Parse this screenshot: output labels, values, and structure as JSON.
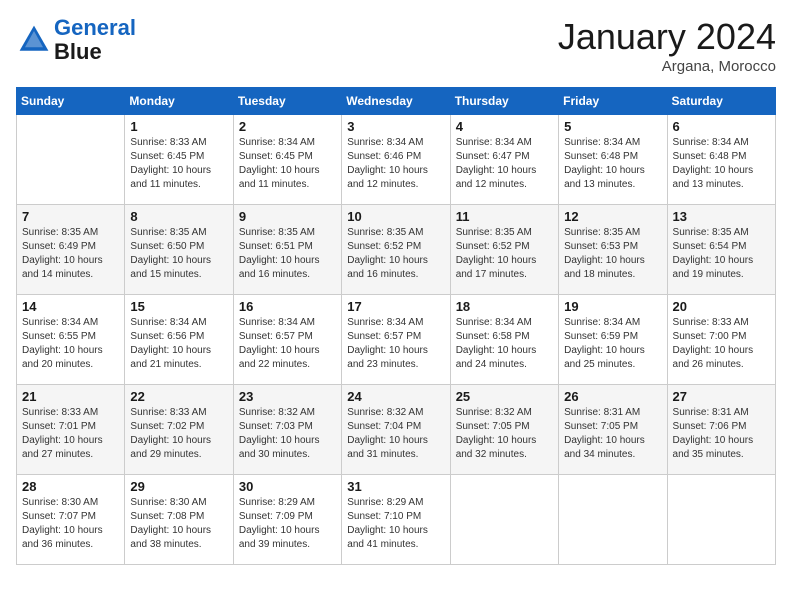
{
  "header": {
    "logo_line1": "General",
    "logo_line2": "Blue",
    "month": "January 2024",
    "location": "Argana, Morocco"
  },
  "weekdays": [
    "Sunday",
    "Monday",
    "Tuesday",
    "Wednesday",
    "Thursday",
    "Friday",
    "Saturday"
  ],
  "weeks": [
    [
      {
        "num": "",
        "sunrise": "",
        "sunset": "",
        "daylight": ""
      },
      {
        "num": "1",
        "sunrise": "Sunrise: 8:33 AM",
        "sunset": "Sunset: 6:45 PM",
        "daylight": "Daylight: 10 hours and 11 minutes."
      },
      {
        "num": "2",
        "sunrise": "Sunrise: 8:34 AM",
        "sunset": "Sunset: 6:45 PM",
        "daylight": "Daylight: 10 hours and 11 minutes."
      },
      {
        "num": "3",
        "sunrise": "Sunrise: 8:34 AM",
        "sunset": "Sunset: 6:46 PM",
        "daylight": "Daylight: 10 hours and 12 minutes."
      },
      {
        "num": "4",
        "sunrise": "Sunrise: 8:34 AM",
        "sunset": "Sunset: 6:47 PM",
        "daylight": "Daylight: 10 hours and 12 minutes."
      },
      {
        "num": "5",
        "sunrise": "Sunrise: 8:34 AM",
        "sunset": "Sunset: 6:48 PM",
        "daylight": "Daylight: 10 hours and 13 minutes."
      },
      {
        "num": "6",
        "sunrise": "Sunrise: 8:34 AM",
        "sunset": "Sunset: 6:48 PM",
        "daylight": "Daylight: 10 hours and 13 minutes."
      }
    ],
    [
      {
        "num": "7",
        "sunrise": "Sunrise: 8:35 AM",
        "sunset": "Sunset: 6:49 PM",
        "daylight": "Daylight: 10 hours and 14 minutes."
      },
      {
        "num": "8",
        "sunrise": "Sunrise: 8:35 AM",
        "sunset": "Sunset: 6:50 PM",
        "daylight": "Daylight: 10 hours and 15 minutes."
      },
      {
        "num": "9",
        "sunrise": "Sunrise: 8:35 AM",
        "sunset": "Sunset: 6:51 PM",
        "daylight": "Daylight: 10 hours and 16 minutes."
      },
      {
        "num": "10",
        "sunrise": "Sunrise: 8:35 AM",
        "sunset": "Sunset: 6:52 PM",
        "daylight": "Daylight: 10 hours and 16 minutes."
      },
      {
        "num": "11",
        "sunrise": "Sunrise: 8:35 AM",
        "sunset": "Sunset: 6:52 PM",
        "daylight": "Daylight: 10 hours and 17 minutes."
      },
      {
        "num": "12",
        "sunrise": "Sunrise: 8:35 AM",
        "sunset": "Sunset: 6:53 PM",
        "daylight": "Daylight: 10 hours and 18 minutes."
      },
      {
        "num": "13",
        "sunrise": "Sunrise: 8:35 AM",
        "sunset": "Sunset: 6:54 PM",
        "daylight": "Daylight: 10 hours and 19 minutes."
      }
    ],
    [
      {
        "num": "14",
        "sunrise": "Sunrise: 8:34 AM",
        "sunset": "Sunset: 6:55 PM",
        "daylight": "Daylight: 10 hours and 20 minutes."
      },
      {
        "num": "15",
        "sunrise": "Sunrise: 8:34 AM",
        "sunset": "Sunset: 6:56 PM",
        "daylight": "Daylight: 10 hours and 21 minutes."
      },
      {
        "num": "16",
        "sunrise": "Sunrise: 8:34 AM",
        "sunset": "Sunset: 6:57 PM",
        "daylight": "Daylight: 10 hours and 22 minutes."
      },
      {
        "num": "17",
        "sunrise": "Sunrise: 8:34 AM",
        "sunset": "Sunset: 6:57 PM",
        "daylight": "Daylight: 10 hours and 23 minutes."
      },
      {
        "num": "18",
        "sunrise": "Sunrise: 8:34 AM",
        "sunset": "Sunset: 6:58 PM",
        "daylight": "Daylight: 10 hours and 24 minutes."
      },
      {
        "num": "19",
        "sunrise": "Sunrise: 8:34 AM",
        "sunset": "Sunset: 6:59 PM",
        "daylight": "Daylight: 10 hours and 25 minutes."
      },
      {
        "num": "20",
        "sunrise": "Sunrise: 8:33 AM",
        "sunset": "Sunset: 7:00 PM",
        "daylight": "Daylight: 10 hours and 26 minutes."
      }
    ],
    [
      {
        "num": "21",
        "sunrise": "Sunrise: 8:33 AM",
        "sunset": "Sunset: 7:01 PM",
        "daylight": "Daylight: 10 hours and 27 minutes."
      },
      {
        "num": "22",
        "sunrise": "Sunrise: 8:33 AM",
        "sunset": "Sunset: 7:02 PM",
        "daylight": "Daylight: 10 hours and 29 minutes."
      },
      {
        "num": "23",
        "sunrise": "Sunrise: 8:32 AM",
        "sunset": "Sunset: 7:03 PM",
        "daylight": "Daylight: 10 hours and 30 minutes."
      },
      {
        "num": "24",
        "sunrise": "Sunrise: 8:32 AM",
        "sunset": "Sunset: 7:04 PM",
        "daylight": "Daylight: 10 hours and 31 minutes."
      },
      {
        "num": "25",
        "sunrise": "Sunrise: 8:32 AM",
        "sunset": "Sunset: 7:05 PM",
        "daylight": "Daylight: 10 hours and 32 minutes."
      },
      {
        "num": "26",
        "sunrise": "Sunrise: 8:31 AM",
        "sunset": "Sunset: 7:05 PM",
        "daylight": "Daylight: 10 hours and 34 minutes."
      },
      {
        "num": "27",
        "sunrise": "Sunrise: 8:31 AM",
        "sunset": "Sunset: 7:06 PM",
        "daylight": "Daylight: 10 hours and 35 minutes."
      }
    ],
    [
      {
        "num": "28",
        "sunrise": "Sunrise: 8:30 AM",
        "sunset": "Sunset: 7:07 PM",
        "daylight": "Daylight: 10 hours and 36 minutes."
      },
      {
        "num": "29",
        "sunrise": "Sunrise: 8:30 AM",
        "sunset": "Sunset: 7:08 PM",
        "daylight": "Daylight: 10 hours and 38 minutes."
      },
      {
        "num": "30",
        "sunrise": "Sunrise: 8:29 AM",
        "sunset": "Sunset: 7:09 PM",
        "daylight": "Daylight: 10 hours and 39 minutes."
      },
      {
        "num": "31",
        "sunrise": "Sunrise: 8:29 AM",
        "sunset": "Sunset: 7:10 PM",
        "daylight": "Daylight: 10 hours and 41 minutes."
      },
      {
        "num": "",
        "sunrise": "",
        "sunset": "",
        "daylight": ""
      },
      {
        "num": "",
        "sunrise": "",
        "sunset": "",
        "daylight": ""
      },
      {
        "num": "",
        "sunrise": "",
        "sunset": "",
        "daylight": ""
      }
    ]
  ]
}
